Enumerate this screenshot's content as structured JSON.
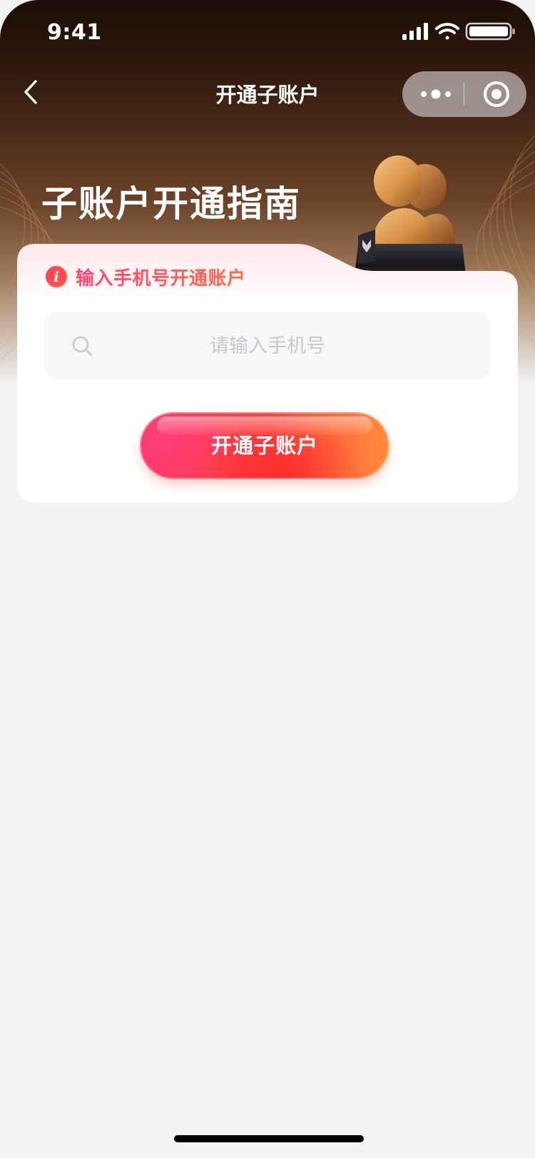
{
  "status_bar": {
    "time": "9:41",
    "icons": [
      "signal-icon",
      "wifi-icon",
      "battery-icon"
    ]
  },
  "nav": {
    "back_icon": "chevron-left-icon",
    "title": "开通子账户",
    "capsule": {
      "more_icon": "more-dots-icon",
      "close_icon": "target-circle-icon"
    }
  },
  "hero": {
    "title": "子账户开通指南",
    "illustration_icon": "users-trophy-icon"
  },
  "card": {
    "notice": {
      "icon": "info-icon",
      "icon_glyph": "i",
      "text": "输入手机号开通账户"
    },
    "search": {
      "icon": "search-icon",
      "placeholder": "请输入手机号",
      "value": ""
    },
    "button_label": "开通子账户"
  },
  "colors": {
    "accent_red": "#ff3f3f",
    "accent_pink": "#ff3a6d",
    "accent_orange": "#ff8c3c",
    "hero_dark": "#1b0d06",
    "page_bg": "#f2f3f5"
  }
}
